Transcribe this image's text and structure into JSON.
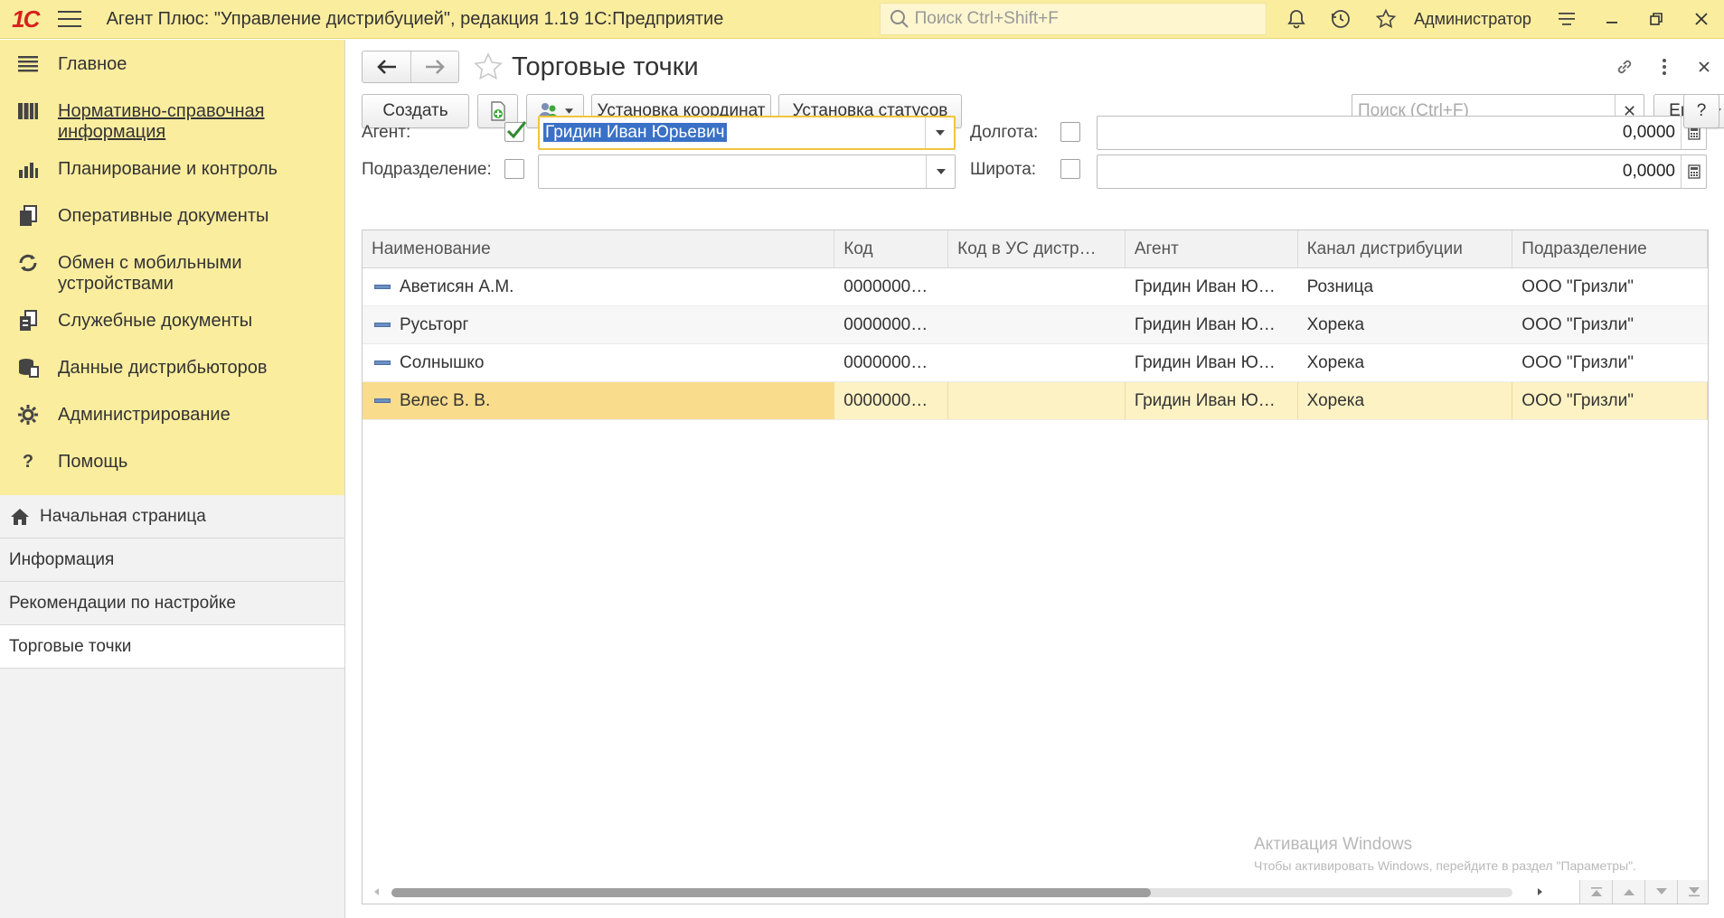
{
  "topbar": {
    "logo": "1С",
    "title": "Агент Плюс: \"Управление дистрибуцией\", редакция 1.19 1С:Предприятие",
    "search_placeholder": "Поиск Ctrl+Shift+F",
    "user": "Администратор"
  },
  "sidebar": {
    "sections": [
      {
        "label": "Главное",
        "icon": "menu-lines-icon"
      },
      {
        "label": "Нормативно-справочная информация",
        "icon": "reference-books-icon"
      },
      {
        "label": "Планирование и контроль",
        "icon": "bar-chart-icon"
      },
      {
        "label": "Оперативные документы",
        "icon": "documents-icon"
      },
      {
        "label": "Обмен с мобильными устройствами",
        "icon": "sync-icon"
      },
      {
        "label": "Служебные документы",
        "icon": "service-docs-icon"
      },
      {
        "label": "Данные дистрибьюторов",
        "icon": "database-icon"
      },
      {
        "label": "Администрирование",
        "icon": "gear-icon"
      },
      {
        "label": "Помощь",
        "icon": "question-icon"
      }
    ],
    "open_windows": [
      {
        "label": "Начальная страница",
        "icon": "home-icon"
      },
      {
        "label": "Информация"
      },
      {
        "label": "Рекомендации по настройке"
      },
      {
        "label": "Торговые точки"
      }
    ]
  },
  "form": {
    "title": "Торговые точки",
    "toolbar": {
      "create": "Создать",
      "set_coords": "Установка координат",
      "set_statuses": "Установка статусов",
      "search_placeholder": "Поиск (Ctrl+F)",
      "more": "Еще",
      "help": "?"
    },
    "filters": {
      "agent_label": "Агент:",
      "agent_checked": true,
      "agent_value": "Гридин Иван Юрьевич",
      "division_label": "Подразделение:",
      "division_checked": false,
      "division_value": "",
      "longitude_label": "Долгота:",
      "longitude_checked": false,
      "longitude_value": "0,0000",
      "latitude_label": "Широта:",
      "latitude_checked": false,
      "latitude_value": "0,0000"
    },
    "table": {
      "columns": [
        "Наименование",
        "Код",
        "Код в УС дистр…",
        "Агент",
        "Канал дистрибуции",
        "Подразделение"
      ],
      "rows": [
        [
          "Аветисян А.М.",
          "0000000…",
          "",
          "Гридин Иван Ю…",
          "Розница",
          "ООО \"Гризли\""
        ],
        [
          "Русьторг",
          "0000000…",
          "",
          "Гридин Иван Ю…",
          "Хорека",
          "ООО \"Гризли\""
        ],
        [
          "Солнышко",
          "0000000…",
          "",
          "Гридин Иван Ю…",
          "Хорека",
          "ООО \"Гризли\""
        ],
        [
          "Велес В. В.",
          "0000000…",
          "",
          "Гридин Иван Ю…",
          "Хорека",
          "ООО \"Гризли\""
        ]
      ],
      "selected_row": 3
    }
  },
  "watermark": {
    "line1": "Активация Windows",
    "line2": "Чтобы активировать Windows, перейдите в раздел \"Параметры\"."
  },
  "colors": {
    "accent_yellow": "#fbed9e",
    "selection_row": "#fdf2c4",
    "logo_red": "#d5221c"
  }
}
